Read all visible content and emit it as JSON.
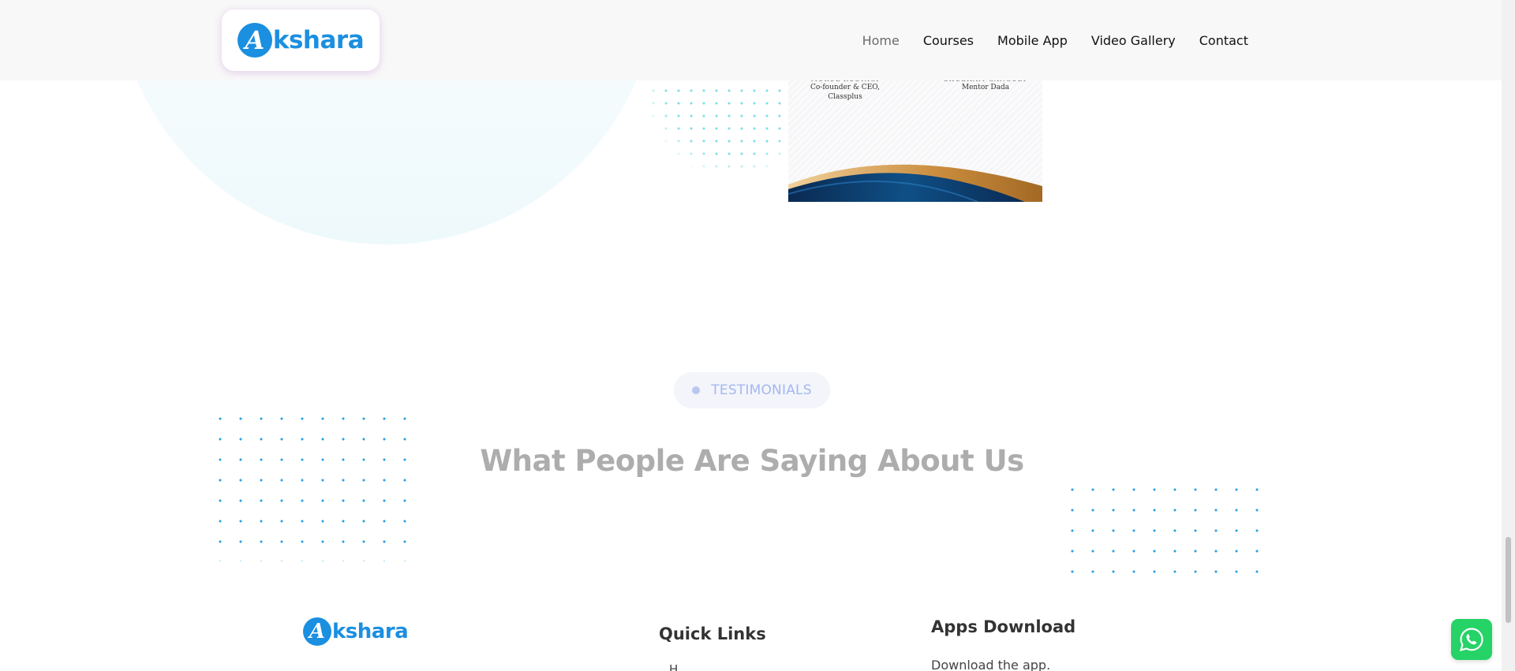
{
  "header": {
    "logo": {
      "mark": "A",
      "word": "kshara"
    },
    "nav": [
      {
        "label": "Home",
        "active": true
      },
      {
        "label": "Courses"
      },
      {
        "label": "Mobile App"
      },
      {
        "label": "Video Gallery"
      },
      {
        "label": "Contact"
      }
    ]
  },
  "certificate": {
    "left_signatory": {
      "name": "MUKUL RUSTAGI",
      "role": "Co-founder & CEO, Classplus"
    },
    "right_signatory": {
      "name": "SHUBHAM GANGULY",
      "role": "Mentor Dada"
    }
  },
  "testimonials": {
    "tag": "TESTIMONIALS",
    "title": "What People Are Saying About Us"
  },
  "footer": {
    "logo": {
      "mark": "A",
      "word": "kshara"
    },
    "quick_links": {
      "title": "Quick Links",
      "first_item": "H"
    },
    "apps_download": {
      "title": "Apps Download",
      "description": "Download the app."
    }
  },
  "colors": {
    "brand_blue": "#1b8fe0",
    "whatsapp_green": "#25d366",
    "header_bg": "#f8f8f8"
  },
  "icons": {
    "floating_button": "whatsapp-icon"
  }
}
